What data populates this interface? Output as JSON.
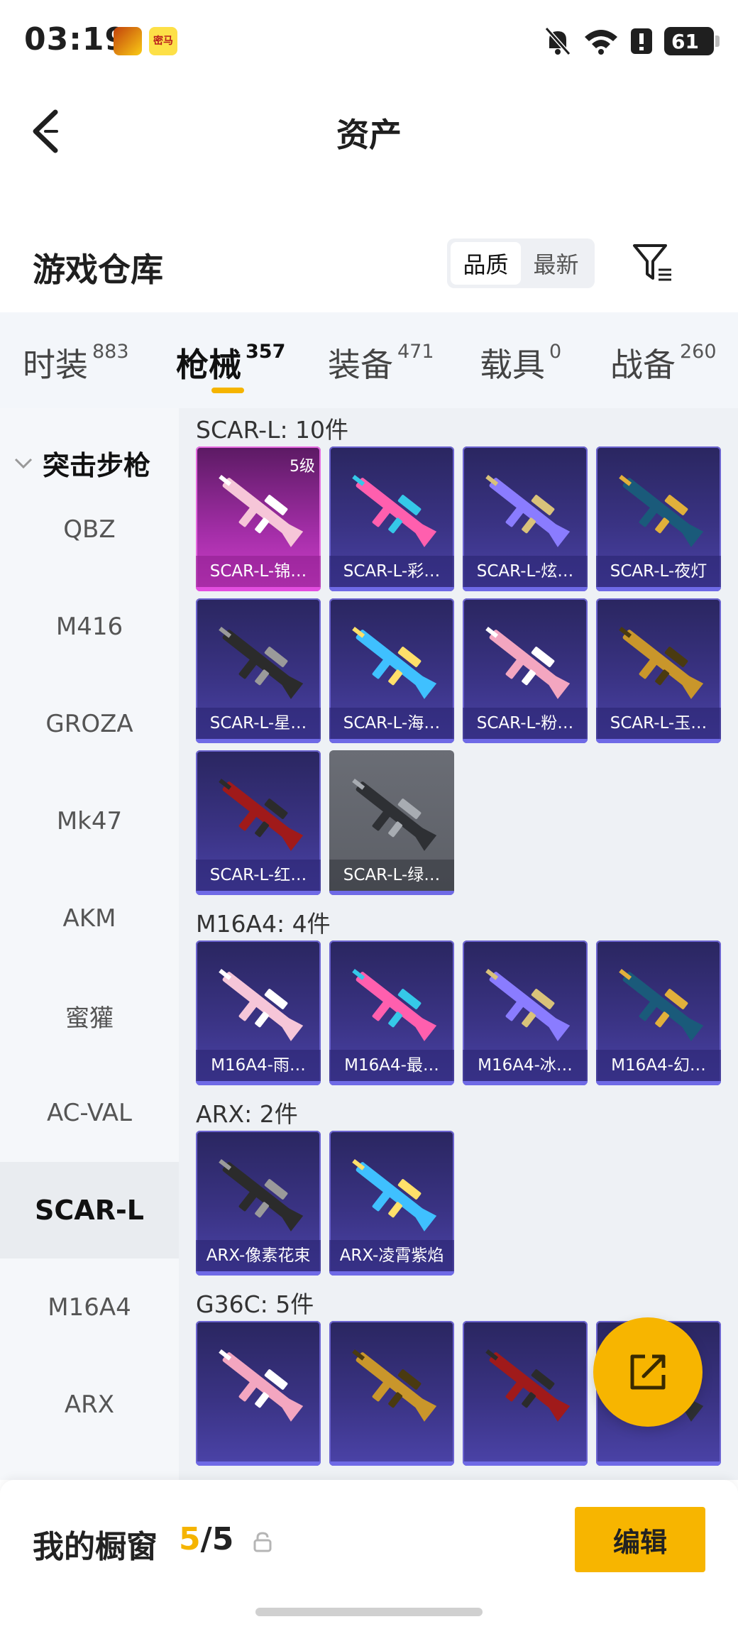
{
  "status_bar": {
    "time": "03:19",
    "app_badge": "密马",
    "battery": "61"
  },
  "nav": {
    "title": "资产"
  },
  "warehouse": {
    "title": "游戏仓库",
    "sort_options": [
      "品质",
      "最新"
    ],
    "active_sort": "品质"
  },
  "tabs": [
    {
      "label": "时装",
      "count": "883"
    },
    {
      "label": "枪械",
      "count": "357"
    },
    {
      "label": "装备",
      "count": "471"
    },
    {
      "label": "载具",
      "count": "0"
    },
    {
      "label": "战备",
      "count": "260"
    }
  ],
  "active_tab": "枪械",
  "sidebar": {
    "group": "突击步枪",
    "items": [
      "QBZ",
      "M416",
      "GROZA",
      "Mk47",
      "AKM",
      "蜜獾",
      "AC-VAL",
      "SCAR-L",
      "M16A4",
      "ARX"
    ],
    "active_item": "SCAR-L"
  },
  "sections": [
    {
      "title": "SCAR-L: 10件",
      "items": [
        {
          "name": "SCAR-L-锦…",
          "level": "5级",
          "style": "pink"
        },
        {
          "name": "SCAR-L-彩…",
          "style": "purple"
        },
        {
          "name": "SCAR-L-炫…",
          "style": "purple"
        },
        {
          "name": "SCAR-L-夜灯",
          "style": "purple"
        },
        {
          "name": "SCAR-L-星…",
          "style": "purple"
        },
        {
          "name": "SCAR-L-海…",
          "style": "purple"
        },
        {
          "name": "SCAR-L-粉…",
          "style": "purple"
        },
        {
          "name": "SCAR-L-玉…",
          "style": "purple"
        },
        {
          "name": "SCAR-L-红…",
          "style": "purple"
        },
        {
          "name": "SCAR-L-绿…",
          "style": "gray"
        }
      ]
    },
    {
      "title": "M16A4: 4件",
      "items": [
        {
          "name": "M16A4-雨…",
          "style": "purple"
        },
        {
          "name": "M16A4-最…",
          "style": "purple"
        },
        {
          "name": "M16A4-冰…",
          "style": "purple"
        },
        {
          "name": "M16A4-幻…",
          "style": "purple"
        }
      ]
    },
    {
      "title": "ARX: 2件",
      "items": [
        {
          "name": "ARX-像素花束",
          "style": "purple"
        },
        {
          "name": "ARX-凌霄紫焰",
          "style": "purple"
        }
      ]
    },
    {
      "title": "G36C: 5件",
      "items": [
        {
          "name": "",
          "style": "purple"
        },
        {
          "name": "",
          "style": "purple"
        },
        {
          "name": "",
          "style": "purple"
        },
        {
          "name": "",
          "style": "purple"
        }
      ]
    }
  ],
  "bottom": {
    "title": "我的橱窗",
    "current": "5",
    "separator": "/",
    "total": "5",
    "edit_label": "编辑"
  },
  "icons": {
    "back": "back-arrow-icon",
    "filter": "filter-icon",
    "fab": "share-external-icon",
    "lock": "lock-icon",
    "chevron": "chevron-down-icon"
  },
  "colors": {
    "accent": "#f7b500",
    "card_purple": "#3a3384",
    "card_pink": "#d040cc",
    "card_gray": "#5c5f66"
  }
}
